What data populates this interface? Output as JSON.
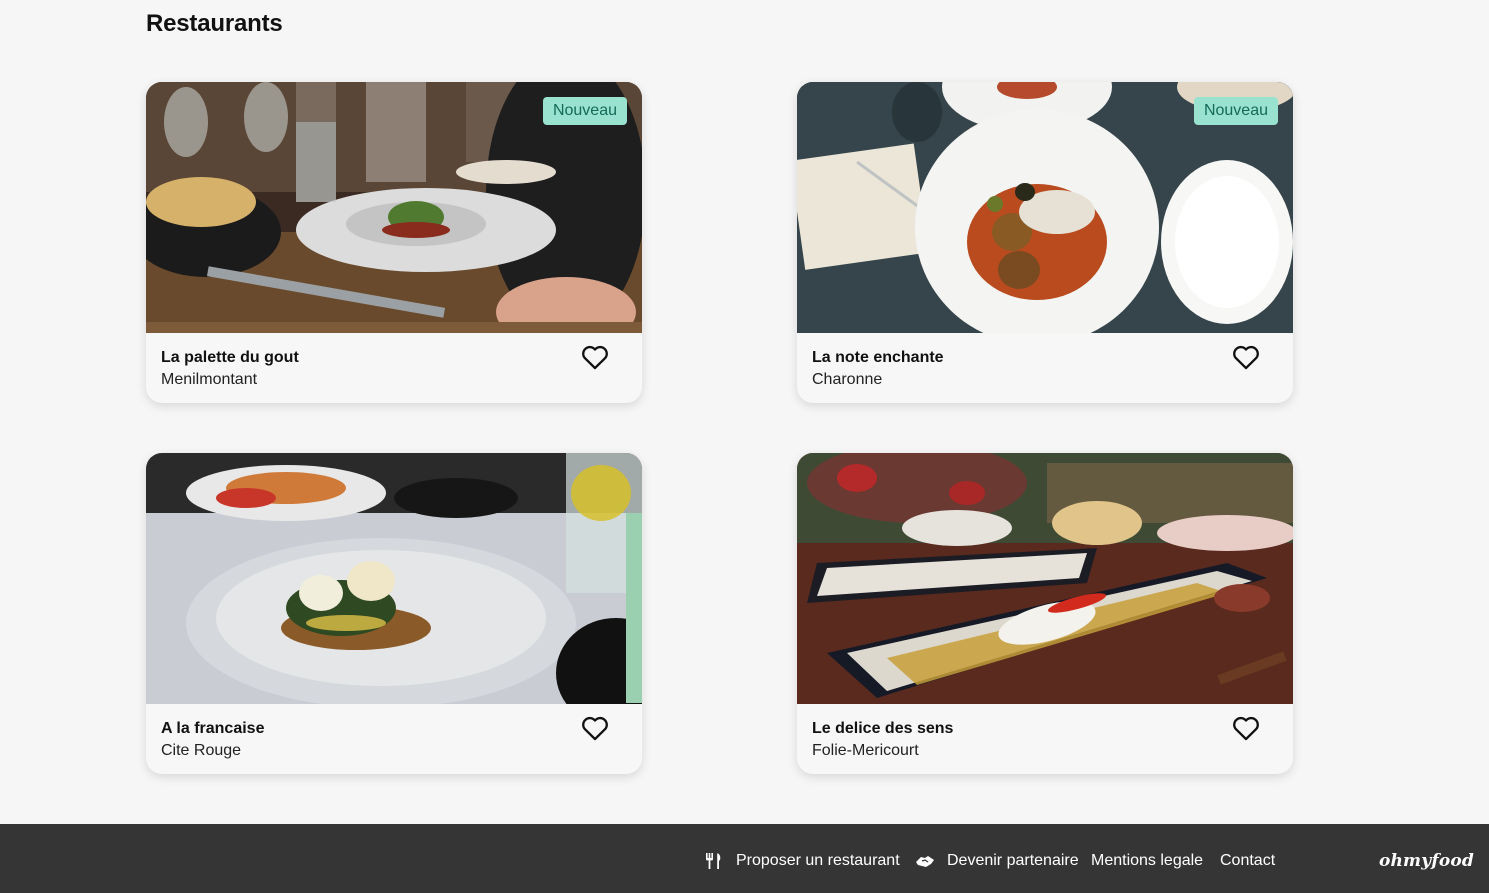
{
  "page": {
    "title": "Restaurants"
  },
  "restaurants": [
    {
      "name": "La palette du gout",
      "location": "Menilmontant",
      "badge": "Nouveau"
    },
    {
      "name": "La note enchante",
      "location": "Charonne",
      "badge": "Nouveau"
    },
    {
      "name": "A la francaise",
      "location": "Cite Rouge",
      "badge": ""
    },
    {
      "name": "Le delice des sens",
      "location": "Folie-Mericourt",
      "badge": ""
    }
  ],
  "icons": {
    "favorite": "heart-icon",
    "propose": "utensils-icon",
    "partner": "handshake-icon"
  },
  "footer": {
    "links": [
      {
        "label": "Proposer un restaurant"
      },
      {
        "label": "Devenir partenaire"
      },
      {
        "label": "Mentions legale"
      },
      {
        "label": "Contact"
      }
    ],
    "logo": "ohmyfood"
  },
  "colors": {
    "badge_bg": "#99e2d0",
    "badge_text": "#146b57",
    "footer_bg": "#353535",
    "page_bg": "#f6f6f6"
  }
}
